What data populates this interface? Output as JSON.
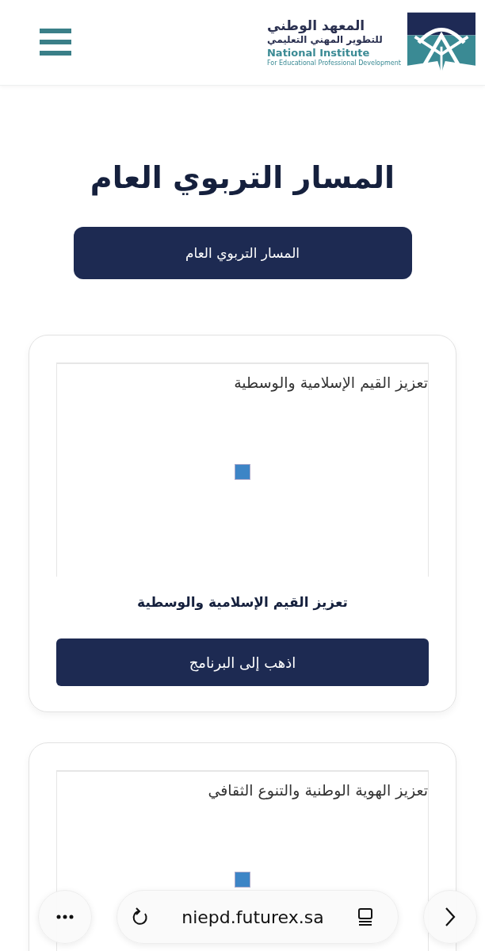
{
  "header": {
    "logo": {
      "arabic_name": "المعهد الوطني",
      "arabic_subtitle": "للتطوير المهني التعليمي",
      "english_name": "National Institute",
      "english_subtitle": "For Educational Professional Development"
    }
  },
  "page_title": "المسار التربوي العام",
  "track_button": "المسار التربوي العام",
  "programs": [
    {
      "embed_title": "تعزيز القيم الإسلامية والوسطية",
      "title": "تعزيز القيم الإسلامية والوسطية",
      "button": "اذهب إلى البرنامج"
    },
    {
      "embed_title": "تعزيز الهوية الوطنية والتنوع الثقافي"
    }
  ],
  "browser_bar": {
    "url": "niepd.futurex.sa"
  }
}
